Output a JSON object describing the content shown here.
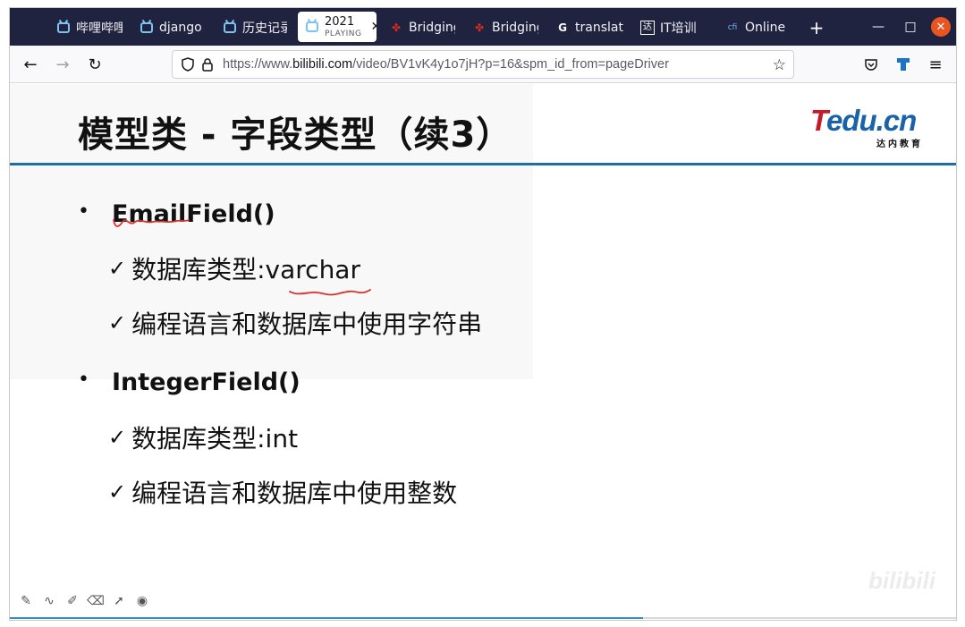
{
  "browser": {
    "tabs": [
      {
        "label": "哔哩哔哩",
        "icon": "bilibili-icon"
      },
      {
        "label": "django",
        "icon": "bilibili-icon"
      },
      {
        "label": "历史记录",
        "icon": "bilibili-icon"
      },
      {
        "label": "2021",
        "sub": "PLAYING",
        "icon": "bilibili-icon",
        "active": true
      },
      {
        "label": "Bridging",
        "icon": "maple-leaf-icon"
      },
      {
        "label": "Bridging",
        "icon": "maple-leaf-icon"
      },
      {
        "label": "translat",
        "icon": "google-icon"
      },
      {
        "label": "IT培训",
        "icon": "da-icon"
      },
      {
        "label": "Online",
        "icon": "cfi-icon"
      }
    ],
    "url_prefix": "https://www.",
    "url_domain": "bilibili.com",
    "url_path": "/video/BV1vK4y1o7jH?p=16&spm_id_from=pageDriver"
  },
  "slide": {
    "title": "模型类 - 字段类型（续3）",
    "logo": {
      "main_t": "T",
      "main_rest": "edu.cn",
      "sub": "达内教育"
    },
    "bullets": [
      {
        "label": "EmailField()",
        "items": [
          "数据库类型:varchar",
          "编程语言和数据库中使用字符串"
        ]
      },
      {
        "label": "IntegerField()",
        "items": [
          "数据库类型:int",
          "编程语言和数据库中使用整数"
        ]
      }
    ],
    "watermark": "bilibili",
    "accent": "#1c6fa1",
    "annotation_color": "#d9302b"
  },
  "player": {
    "progress_fraction": 0.668
  }
}
